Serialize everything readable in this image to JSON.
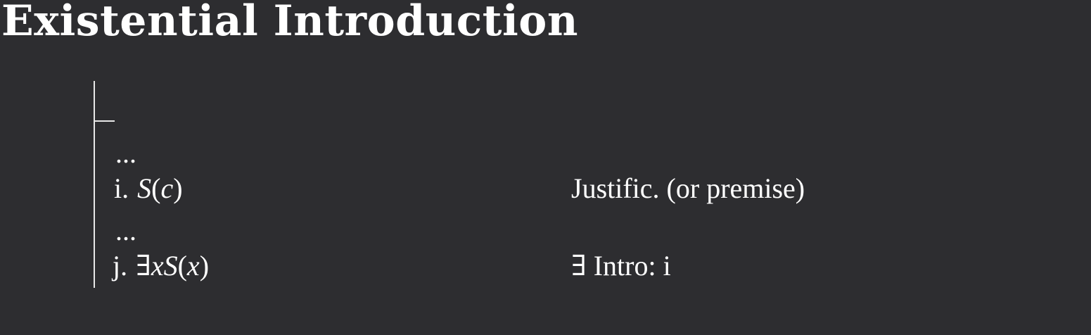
{
  "title": "Existential Introduction",
  "proof": {
    "ellipsis_1": "...",
    "line_i": {
      "number": "i.",
      "pred": "S",
      "open": "(",
      "arg": "c",
      "close": ")",
      "justification": "Justific. (or premise)"
    },
    "ellipsis_2": "...",
    "line_j": {
      "number": "j.",
      "quant": "∃",
      "var": "x",
      "pred": "S",
      "open": "(",
      "arg": "x",
      "close": ")",
      "justification": "∃ Intro: i"
    }
  }
}
